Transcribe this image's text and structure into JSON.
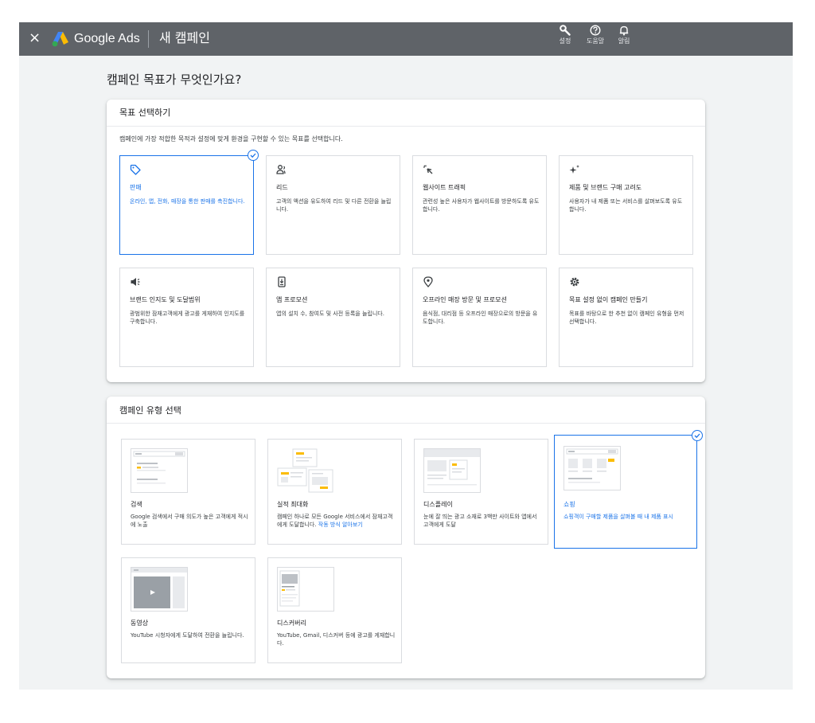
{
  "header": {
    "close_label": "×",
    "brand": "Google Ads",
    "title": "새 캠페인",
    "icons": [
      {
        "name": "wrench-icon",
        "label": "설정"
      },
      {
        "name": "help-icon",
        "label": "도움말"
      },
      {
        "name": "bell-icon",
        "label": "알림"
      }
    ]
  },
  "page": {
    "title": "캠페인 목표가 무엇인가요?"
  },
  "goal_section": {
    "heading": "목표 선택하기",
    "description": "캠페인에 가장 적합한 목적과 설정에 맞게 환경을 구현할 수 있는 목표를 선택합니다.",
    "selected": "판매",
    "goals": [
      {
        "icon": "tag-icon",
        "title": "판매",
        "description": "온라인, 앱, 전화, 매장을 통한 판매를 촉진합니다."
      },
      {
        "icon": "people-icon",
        "title": "리드",
        "description": "고객의 액션을 유도하여 리드 및 다른 전환을 늘립니다."
      },
      {
        "icon": "click-icon",
        "title": "웹사이트 트래픽",
        "description": "관련성 높은 사용자가 웹사이트를 방문하도록 유도합니다."
      },
      {
        "icon": "sparkle-icon",
        "title": "제품 및 브랜드 구매 고려도",
        "description": "사용자가 내 제품 또는 서비스를 살펴보도록 유도합니다."
      },
      {
        "icon": "megaphone-icon",
        "title": "브랜드 인지도 및 도달범위",
        "description": "광범위한 잠재고객에게 광고를 게재하여 인지도를 구축합니다."
      },
      {
        "icon": "phone-download-icon",
        "title": "앱 프로모션",
        "description": "앱의 설치 수, 참여도 및 사전 등록을 늘립니다."
      },
      {
        "icon": "location-pin-icon",
        "title": "오프라인 매장 방문 및 프로모션",
        "description": "음식점, 대리점 등 오프라인 매장으로의 방문을 유도합니다."
      },
      {
        "icon": "gear-icon",
        "title": "목표 설정 없이 캠페인 만들기",
        "description": "목표를 바탕으로 한 추천 없이 캠페인 유형을 먼저 선택합니다."
      }
    ]
  },
  "type_section": {
    "heading": "캠페인 유형 선택",
    "selected": "쇼핑",
    "types": [
      {
        "thumb": "search-thumb",
        "title": "검색",
        "description": "Google 검색에서 구매 의도가 높은 고객에게 적시에 노출",
        "link": ""
      },
      {
        "thumb": "pmax-thumb",
        "title": "실적 최대화",
        "description": "캠페인 하나로 모든 Google 서비스에서 잠재고객에게 도달합니다. ",
        "link": "작동 방식 알아보기"
      },
      {
        "thumb": "display-thumb",
        "title": "디스플레이",
        "description": "눈에 잘 띄는 광고 소재로 3백만 사이트와 앱에서 고객에게 도달",
        "link": ""
      },
      {
        "thumb": "shopping-thumb",
        "title": "쇼핑",
        "description": "쇼핑객이 구매할 제품을 살펴볼 때 내 제품 표시",
        "link": ""
      },
      {
        "thumb": "video-thumb",
        "title": "동영상",
        "description": "YouTube 시청자에게 도달하여 전환을 늘립니다.",
        "link": ""
      },
      {
        "thumb": "discovery-thumb",
        "title": "디스커버리",
        "description": "YouTube, Gmail, 디스커버 등에 광고를 게재합니다.",
        "link": ""
      }
    ]
  },
  "colors": {
    "accent": "#1a73e8",
    "topbar": "#5f6368",
    "yellow": "#fbbc04"
  }
}
